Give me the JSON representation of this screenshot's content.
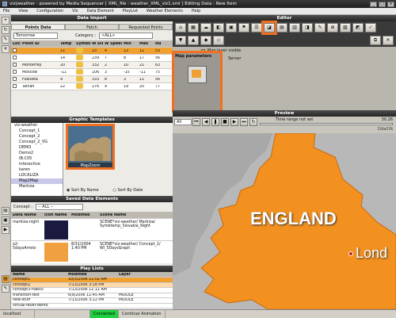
{
  "window": {
    "title": "viz|weather - powered by Media Sequencer [ XML_file : weather_XML_viz1.xml ]        Editing Data : New Item",
    "min": "_",
    "max": "□",
    "close": "x"
  },
  "menu": [
    "File",
    "View",
    "Configuration",
    "Viz",
    "Data Element",
    "PlayList",
    "Weather Elements",
    "Help"
  ],
  "data_import": {
    "title": "Data Import",
    "tabs": [
      "Points Data",
      "Fetch",
      "Requested Points"
    ],
    "forecast": "Tomorrow",
    "category_label": "Category :",
    "category_value": "<ALL>",
    "columns": [
      "Lock",
      "Point ID",
      "Temp",
      "Symbol",
      "W Dir",
      "W Speed",
      "Min",
      "Max",
      "Hu"
    ],
    "rows": [
      {
        "id": "",
        "temp": "11",
        "dir": "23",
        "speed": "4",
        "min": "13",
        "max": "11",
        "hu": "53"
      },
      {
        "id": "",
        "temp": "14",
        "dir": "239",
        "speed": "7",
        "min": "8",
        "max": "17",
        "hu": "56"
      },
      {
        "id": "Monterrey",
        "temp": "20",
        "dir": "332",
        "speed": "2",
        "min": "10",
        "max": "21",
        "hu": "63"
      },
      {
        "id": "Moscow",
        "temp": "-11",
        "dir": "106",
        "speed": "3",
        "min": "-15",
        "max": "-11",
        "hu": "75"
      },
      {
        "id": "Fukuoka",
        "temp": "9",
        "dir": "333",
        "speed": "8",
        "min": "3",
        "max": "11",
        "hu": "56"
      },
      {
        "id": "Tainan",
        "temp": "22",
        "dir": "276",
        "speed": "9",
        "min": "19",
        "max": "20",
        "hu": "77"
      }
    ]
  },
  "graphic_templates": {
    "title": "Graphic Templates",
    "tree": [
      "viz-weather",
      "Concept_1",
      "Concept_2",
      "Concept_2_VG",
      "DEMO",
      "Demo2",
      "IB.C05",
      "interactive",
      "karen",
      "LOCALIZA",
      "Map2Map",
      "Markiza"
    ],
    "thumb_label": "MapZoom",
    "sort_name": "Sort By Name",
    "sort_date": "Sort By Date"
  },
  "saved_data": {
    "title": "Saved Data Elements",
    "concept_label": "Concept :",
    "concept_value": "-- ALL --",
    "columns": [
      "Data Name",
      "Icon Name",
      "Modified",
      "Scene Name"
    ],
    "rows": [
      {
        "name": "markiza-night",
        "modified": "",
        "scene": "SCENE*viz-weather/ Markiza/ Symbtemp_Slovakia_Night"
      },
      {
        "name": "o2-5daysArrote",
        "modified": "8/31/2004 1:40 PM",
        "scene": "SCENE*viz-weather/ Concept_2/ WI_5DaysGraph"
      }
    ]
  },
  "play_lists": {
    "title": "Play Lists",
    "columns": [
      "Name",
      "Modified",
      "Layer"
    ],
    "rows": [
      {
        "name": "concept1",
        "modified": "10/3/2006 11:02 AM",
        "layer": ""
      },
      {
        "name": "concept2",
        "modified": "7/13/2006 3:18 PM",
        "layer": ""
      },
      {
        "name": "concept3-nab05",
        "modified": "7/13/2006 11:11 AM",
        "layer": ""
      },
      {
        "name": "transition-test",
        "modified": "6/9/2006 11:45 AM",
        "layer": "MIDDLE"
      },
      {
        "name": "new-stuff",
        "modified": "7/13/2006 3:12 PM",
        "layer": "MIDDLE"
      },
      {
        "name": "virtual-fever-demo",
        "modified": "",
        "layer": ""
      }
    ]
  },
  "editor": {
    "title": "Editor",
    "map_layer": "Map layer visible",
    "server": "Server",
    "map_params": "Map parameters"
  },
  "preview": {
    "title": "Preview",
    "all": "All",
    "range": "Time range not set",
    "time": "30.26",
    "size": "720x576",
    "map_text": "ENGLAND",
    "city": "Lond"
  },
  "status": {
    "host": "localhost",
    "connected": "Connected",
    "animation": "Continue Animation"
  },
  "colors": {
    "accent": "#f07020",
    "sea": "#b8b8b8",
    "land": "#f29020"
  }
}
